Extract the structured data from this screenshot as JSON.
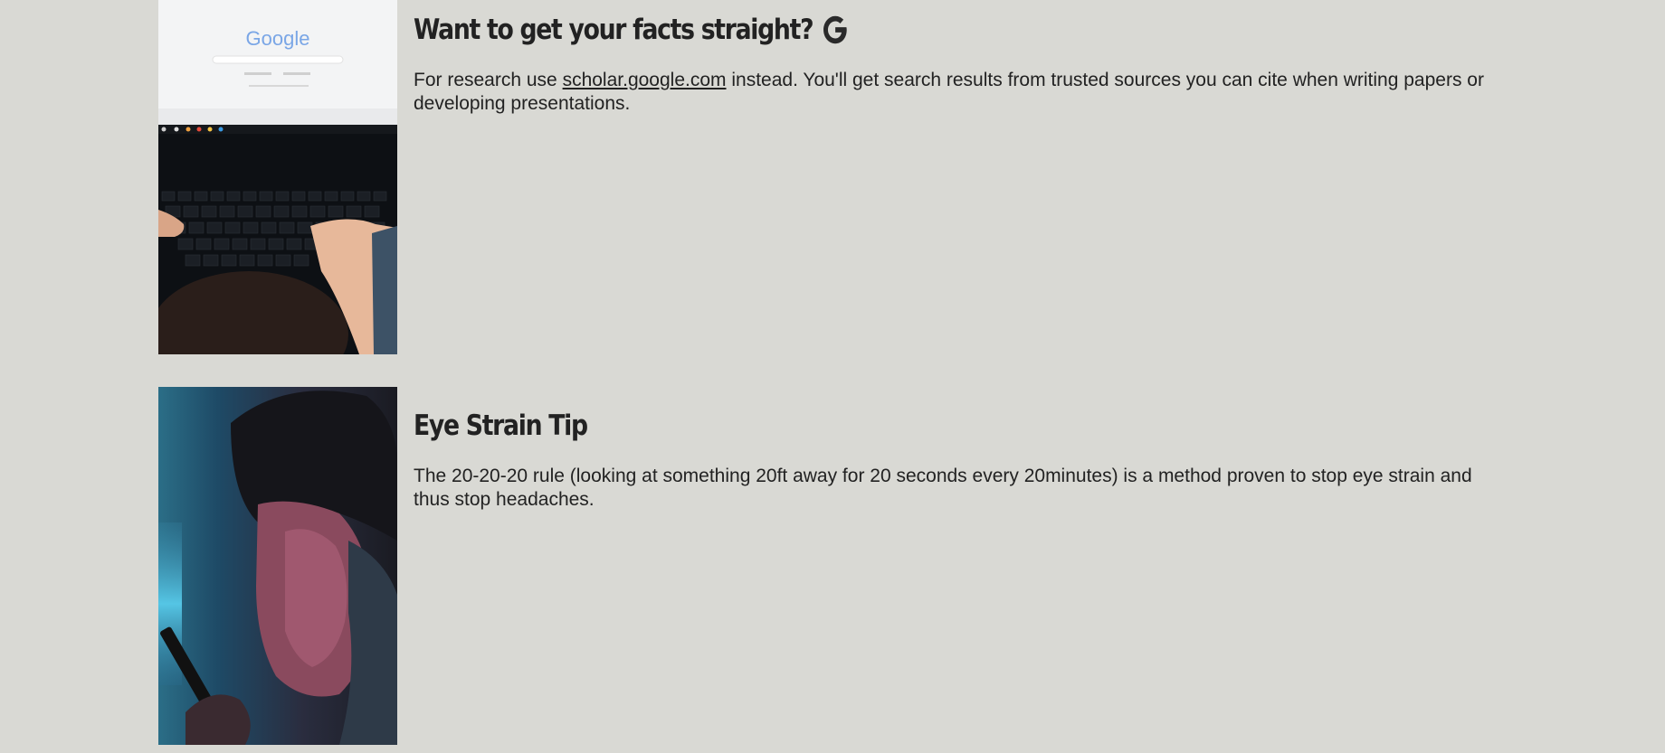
{
  "tips": [
    {
      "title": "Want to get your facts straight?",
      "icon": "google-g-icon",
      "desc_before": "For research use ",
      "link_text": "scholar.google.com",
      "desc_after": " instead. You'll get search results from trusted sources you can cite when writing papers or developing presentations.",
      "image": {
        "alt": "Hands typing on a laptop showing the Google homepage",
        "screen_text": "Google"
      }
    },
    {
      "title": "Eye Strain Tip",
      "desc": "The 20-20-20 rule (looking at something 20ft away for 20 seconds every 20minutes) is a method proven to stop eye strain and thus stop headaches.",
      "image": {
        "alt": "Person covering face with hands while holding a phone"
      }
    }
  ],
  "colors": {
    "background": "#d9d9d4",
    "text": "#222222"
  }
}
